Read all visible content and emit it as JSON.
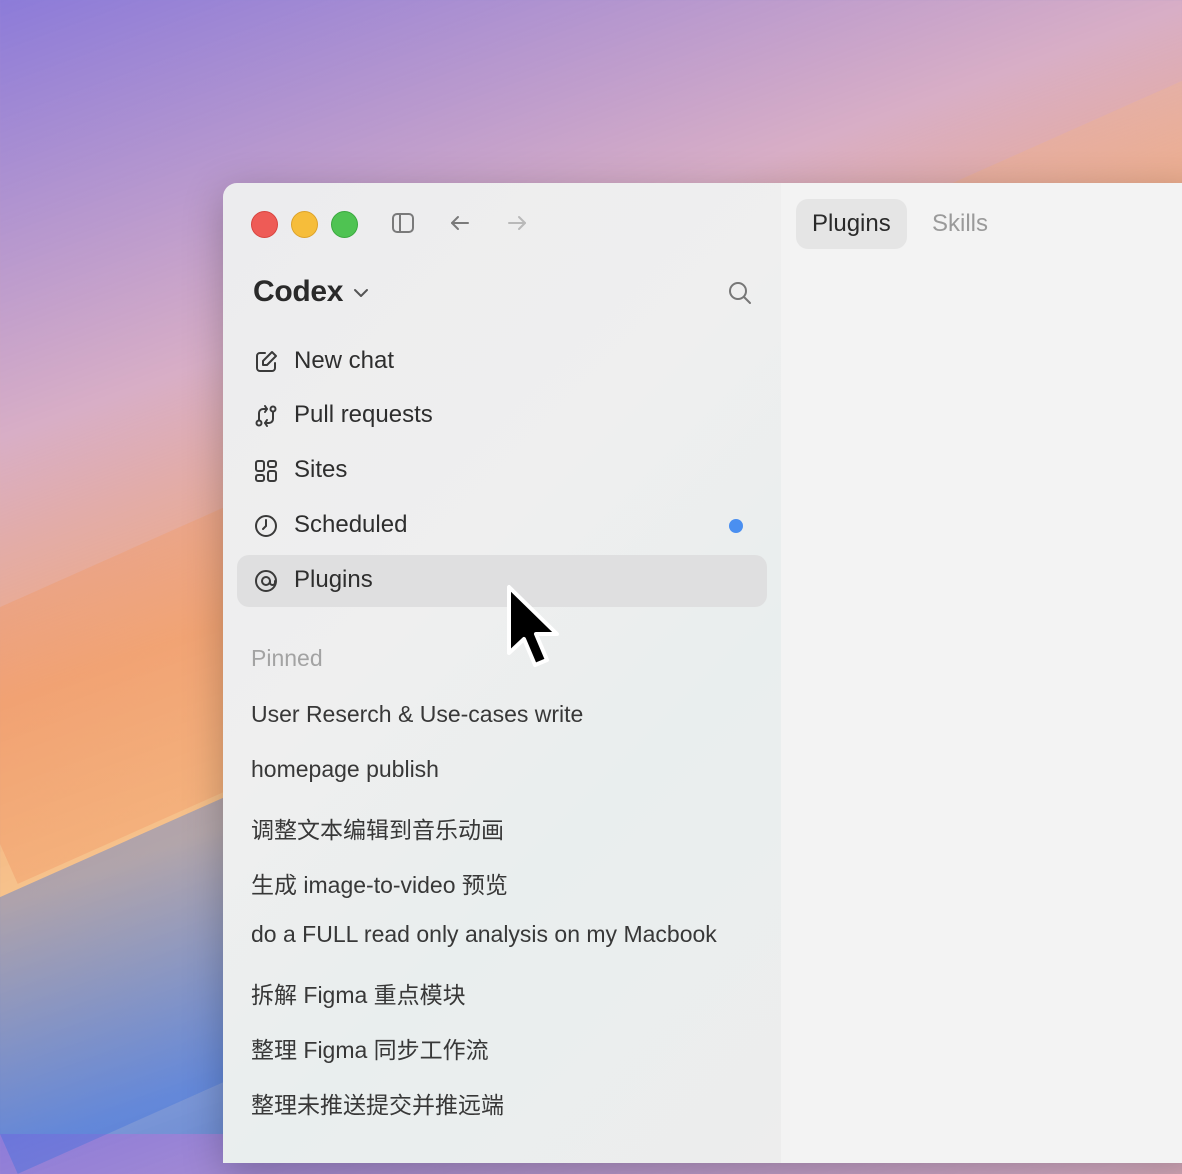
{
  "app": {
    "title": "Codex"
  },
  "nav": [
    {
      "label": "New chat",
      "icon": "compose-icon"
    },
    {
      "label": "Pull requests",
      "icon": "git-pull-request-icon"
    },
    {
      "label": "Sites",
      "icon": "grid-icon"
    },
    {
      "label": "Scheduled",
      "icon": "clock-icon",
      "badge_color": "#4a8ff0"
    },
    {
      "label": "Plugins",
      "icon": "plugin-icon",
      "active": true
    }
  ],
  "pinned": {
    "title": "Pinned",
    "items": [
      "User Reserch & Use-cases write",
      "homepage publish",
      "调整文本编辑到音乐动画",
      "生成 image-to-video 预览",
      "do a FULL read only analysis on my Macbook",
      "拆解 Figma 重点模块",
      "整理 Figma 同步工作流",
      "整理未推送提交并推远端"
    ]
  },
  "tabs": [
    {
      "label": "Plugins",
      "active": true
    },
    {
      "label": "Skills",
      "active": false
    }
  ],
  "colors": {
    "accent": "#4a8ff0",
    "close": "#ee5b56",
    "minimize": "#f6bd3a",
    "maximize": "#4fc352"
  }
}
